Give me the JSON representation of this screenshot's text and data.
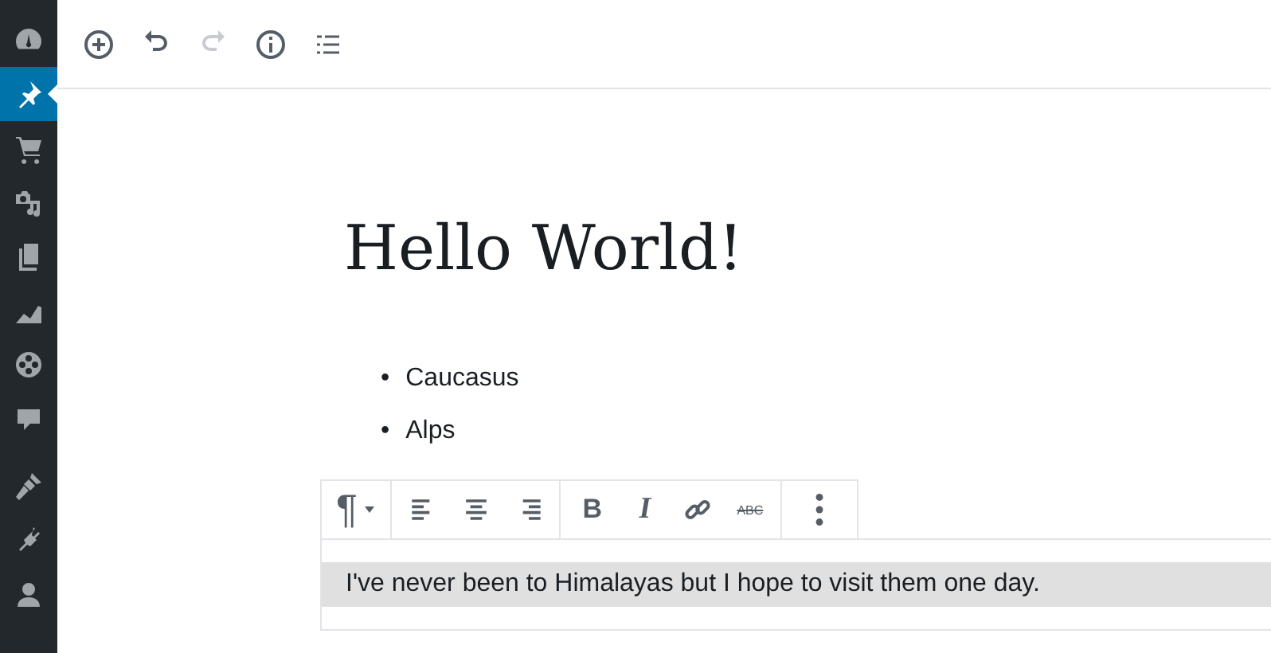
{
  "sidebar": {
    "items": [
      {
        "kind": "dashboard",
        "selected": false
      },
      {
        "kind": "pin",
        "selected": true
      },
      {
        "kind": "cart",
        "selected": false
      },
      {
        "kind": "media",
        "selected": false
      },
      {
        "kind": "pages",
        "selected": false
      },
      {
        "kind": "chart",
        "selected": false
      },
      {
        "kind": "wheel",
        "selected": false
      },
      {
        "kind": "comment",
        "selected": false
      },
      {
        "kind": "brush",
        "selected": false
      },
      {
        "kind": "plug",
        "selected": false
      },
      {
        "kind": "user",
        "selected": false
      }
    ]
  },
  "toolbar": {
    "items": [
      {
        "kind": "add",
        "disabled": false
      },
      {
        "kind": "undo",
        "disabled": false
      },
      {
        "kind": "redo",
        "disabled": true
      },
      {
        "kind": "info",
        "disabled": false
      },
      {
        "kind": "outline",
        "disabled": false
      }
    ]
  },
  "post": {
    "title": "Hello World!",
    "list": [
      {
        "marker": "•",
        "text": "Caucasus"
      },
      {
        "marker": "•",
        "text": "Alps"
      }
    ]
  },
  "block_toolbar": {
    "groups": [
      [
        {
          "kind": "block-type",
          "label": "¶"
        }
      ],
      [
        {
          "kind": "align-left"
        },
        {
          "kind": "align-center"
        },
        {
          "kind": "align-right"
        }
      ],
      [
        {
          "kind": "bold",
          "label": "B"
        },
        {
          "kind": "italic",
          "label": "I"
        },
        {
          "kind": "link"
        },
        {
          "kind": "strike",
          "label": "ABC"
        }
      ],
      [
        {
          "kind": "more"
        }
      ]
    ]
  },
  "paragraph": {
    "text": "I've never been to Himalayas but I hope to visit them one day.",
    "selected": true
  }
}
